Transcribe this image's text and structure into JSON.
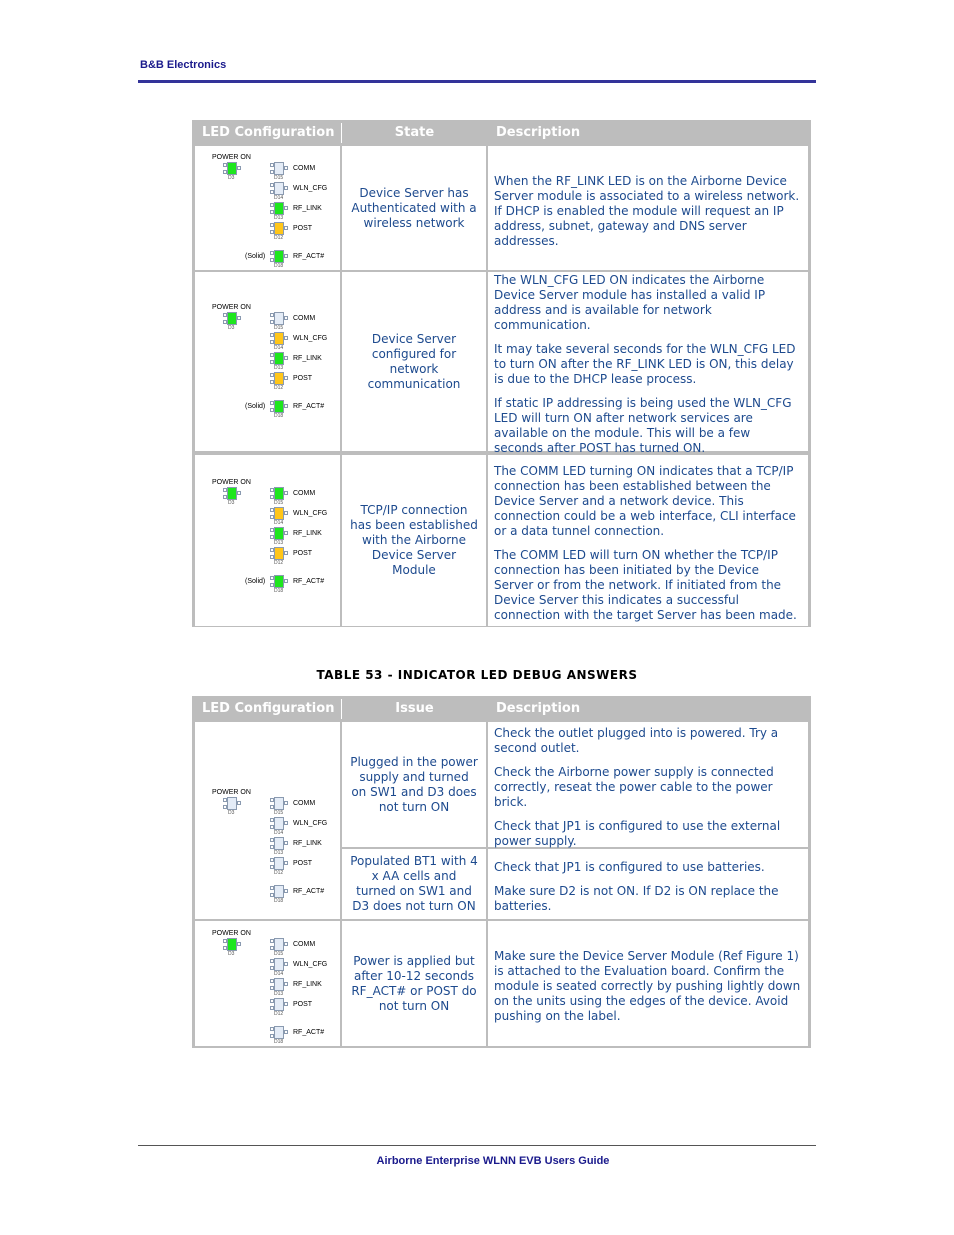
{
  "header": {
    "company": "B&B Electronics"
  },
  "footer": {
    "title": "Airborne Enterprise WLNN EVB Users Guide"
  },
  "colors": {
    "green": "#1ee61e",
    "yellow": "#ffc61a",
    "off": "#e4ecf7",
    "header_bg": "#bdbdbd",
    "text": "#1d4a8e"
  },
  "diagram_labels": {
    "power_on": "POWER ON",
    "solid": "(Solid)",
    "d3": "D3",
    "leds": [
      {
        "name": "COMM",
        "ref": "D15"
      },
      {
        "name": "WLN_CFG",
        "ref": "D14"
      },
      {
        "name": "RF_LINK",
        "ref": "D13"
      },
      {
        "name": "POST",
        "ref": "D12"
      },
      {
        "name": "RF_ACT#",
        "ref": "D18"
      }
    ]
  },
  "table1": {
    "headers": [
      "LED Configuration",
      "State",
      "Description"
    ],
    "rows": [
      {
        "leds": {
          "d3": "green",
          "comm": "off",
          "wln_cfg": "off",
          "rf_link": "green",
          "post": "yellow",
          "rf_act": "green"
        },
        "solid": true,
        "state": "Device Server has Authenticated with a wireless network",
        "description": [
          "When the RF_LINK LED is on the Airborne Device Server module is associated to a wireless network. If DHCP is enabled the module will request an IP address, subnet, gateway and DNS server addresses."
        ]
      },
      {
        "leds": {
          "d3": "green",
          "comm": "off",
          "wln_cfg": "yellow",
          "rf_link": "green",
          "post": "yellow",
          "rf_act": "green"
        },
        "solid": true,
        "state": "Device Server configured for network communication",
        "description": [
          "The WLN_CFG LED ON indicates the Airborne Device Server module has installed a valid IP address and is available for network communication.",
          "It may take several seconds for the WLN_CFG LED to turn ON after the RF_LINK LED is ON, this delay is due to the DHCP lease process.",
          "If static IP addressing is being used the WLN_CFG LED will turn ON after network services are available on the module. This will be a few seconds after POST has turned ON."
        ]
      },
      {
        "leds": {
          "d3": "green",
          "comm": "green",
          "wln_cfg": "yellow",
          "rf_link": "green",
          "post": "yellow",
          "rf_act": "green"
        },
        "solid": true,
        "state": "TCP/IP connection has been established with the Airborne Device Server Module",
        "description": [
          "The COMM LED turning ON indicates that a TCP/IP connection has been established between the Device Server and a network device. This connection could be a web interface, CLI interface or a data tunnel connection.",
          "The COMM LED will turn ON whether the TCP/IP connection has been initiated by the Device Server or from the network. If initiated from the Device Server this indicates a successful connection with the target Server has been made."
        ]
      }
    ]
  },
  "table2": {
    "caption": "TABLE 53  - INDICATOR LED DEBUG ANSWERS",
    "headers": [
      "LED Configuration",
      "Issue",
      "Description"
    ],
    "rows": [
      {
        "leds": {
          "d3": "off",
          "comm": "off",
          "wln_cfg": "off",
          "rf_link": "off",
          "post": "off",
          "rf_act": "off"
        },
        "solid": false,
        "issues": [
          {
            "issue": "Plugged in the power supply and turned on SW1 and D3 does not turn ON",
            "description": [
              "Check the outlet plugged into is powered. Try a second outlet.",
              "Check the Airborne power supply is connected correctly, reseat the power cable to the power brick.",
              "Check that JP1 is configured to use the external power supply."
            ]
          },
          {
            "issue": "Populated BT1 with 4 x AA cells and turned on SW1 and D3 does not turn ON",
            "description": [
              "Check that JP1 is configured to use batteries.",
              "Make sure D2 is not ON. If D2 is ON replace the batteries."
            ]
          }
        ]
      },
      {
        "leds": {
          "d3": "green",
          "comm": "off",
          "wln_cfg": "off",
          "rf_link": "off",
          "post": "off",
          "rf_act": "off"
        },
        "solid": false,
        "issues": [
          {
            "issue": "Power is applied but after 10-12 seconds RF_ACT# or POST do not turn ON",
            "description": [
              "Make sure the Device Server Module (Ref Figure 1) is attached to the Evaluation board. Confirm the module is seated correctly by pushing lightly down on the units using the edges of the device. Avoid pushing on the label."
            ]
          }
        ]
      }
    ]
  }
}
